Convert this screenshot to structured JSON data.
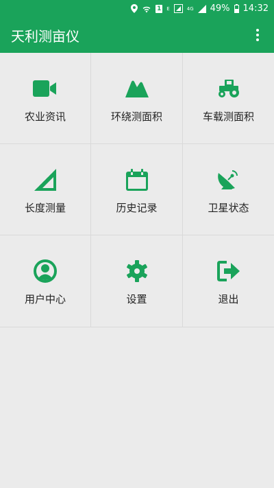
{
  "status_bar": {
    "network_e": "E",
    "network_4g": "4G",
    "sim_label": "1",
    "battery_percent": "49%",
    "time": "14:32"
  },
  "app_bar": {
    "title": "天利测亩仪"
  },
  "accent_color": "#1aa35a",
  "menu": [
    {
      "label": "农业资讯",
      "icon": "video-camera-icon"
    },
    {
      "label": "环绕测面积",
      "icon": "mountain-icon"
    },
    {
      "label": "车载测面积",
      "icon": "tractor-icon"
    },
    {
      "label": "长度测量",
      "icon": "ruler-triangle-icon"
    },
    {
      "label": "历史记录",
      "icon": "calendar-icon"
    },
    {
      "label": "卫星状态",
      "icon": "satellite-dish-icon"
    },
    {
      "label": "用户中心",
      "icon": "user-circle-icon"
    },
    {
      "label": "设置",
      "icon": "gear-icon"
    },
    {
      "label": "退出",
      "icon": "exit-icon"
    }
  ]
}
